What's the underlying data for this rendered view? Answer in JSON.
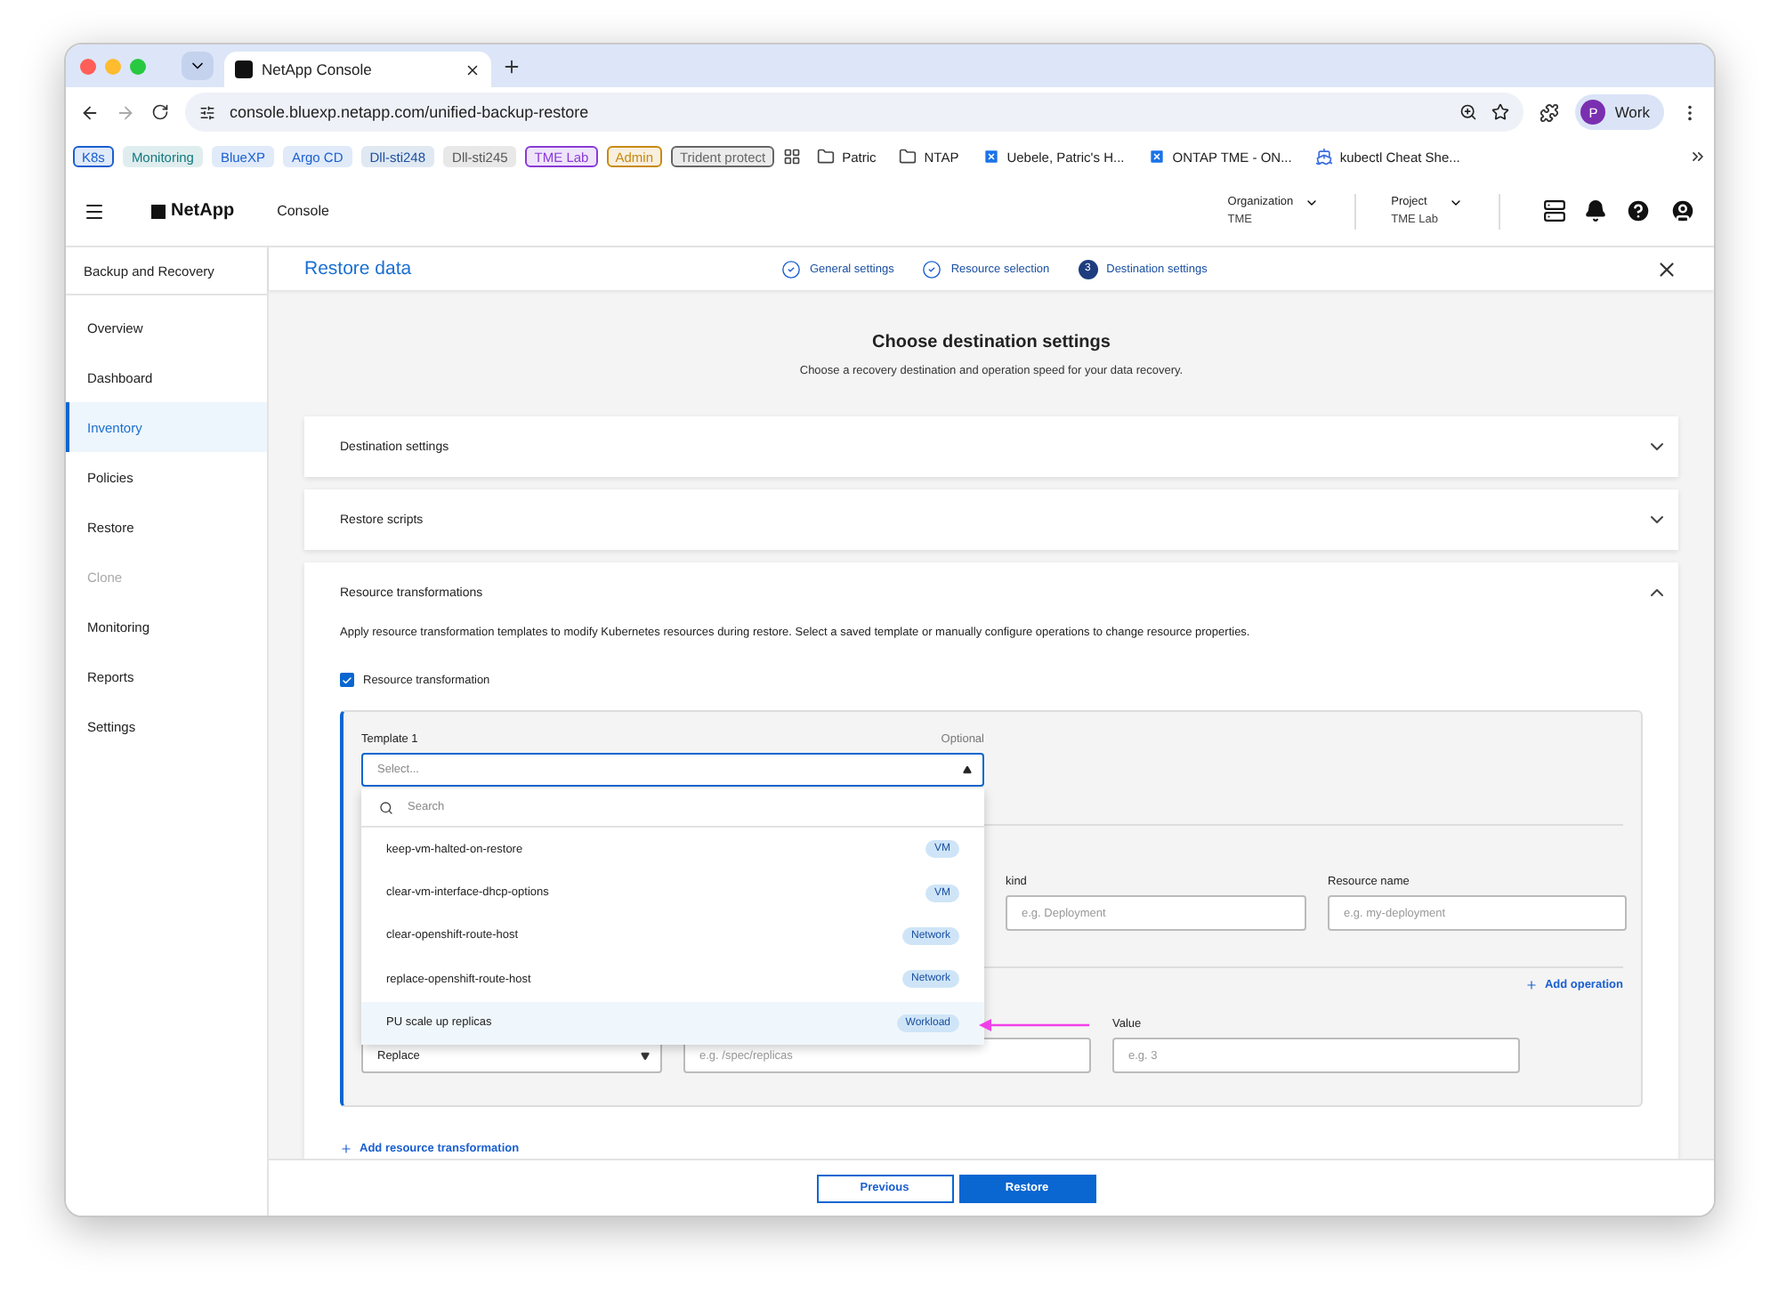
{
  "browser": {
    "tab_title": "NetApp Console",
    "url": "console.bluexp.netapp.com/unified-backup-restore",
    "profile": {
      "initial": "P",
      "name": "Work"
    },
    "bookmarks": [
      {
        "kind": "chip",
        "label": "K8s",
        "color": "#1a5fd0",
        "outlined": true
      },
      {
        "kind": "chip",
        "label": "Monitoring",
        "color": "#137a7f",
        "outlined": false
      },
      {
        "kind": "chip",
        "label": "BlueXP",
        "color": "#1a5fd0",
        "outlined": false
      },
      {
        "kind": "chip",
        "label": "Argo CD",
        "color": "#1a5fd0",
        "outlined": false
      },
      {
        "kind": "chip",
        "label": "Dll-sti248",
        "color": "#1a4fa0",
        "outlined": false
      },
      {
        "kind": "chip",
        "label": "Dll-sti245",
        "color": "#555555",
        "outlined": false
      },
      {
        "kind": "chip",
        "label": "TME Lab",
        "color": "#8a3ad6",
        "outlined": true
      },
      {
        "kind": "chip",
        "label": "Admin",
        "color": "#c88a10",
        "outlined": true
      },
      {
        "kind": "chip",
        "label": "Trident protect",
        "color": "#666666",
        "outlined": true
      },
      {
        "kind": "apps"
      },
      {
        "kind": "folder",
        "label": "Patric"
      },
      {
        "kind": "folder",
        "label": "NTAP"
      },
      {
        "kind": "page",
        "label": "Uebele, Patric's H..."
      },
      {
        "kind": "page",
        "label": "ONTAP TME - ON..."
      },
      {
        "kind": "wheel",
        "label": "kubectl Cheat She..."
      }
    ]
  },
  "app_header": {
    "logo": "NetApp",
    "product": "Console",
    "organization": {
      "label": "Organization",
      "value": "TME"
    },
    "project": {
      "label": "Project",
      "value": "TME Lab"
    }
  },
  "sidebar": {
    "title": "Backup and Recovery",
    "items": [
      {
        "label": "Overview",
        "selected": false,
        "disabled": false
      },
      {
        "label": "Dashboard",
        "selected": false,
        "disabled": false
      },
      {
        "label": "Inventory",
        "selected": true,
        "disabled": false
      },
      {
        "label": "Policies",
        "selected": false,
        "disabled": false
      },
      {
        "label": "Restore",
        "selected": false,
        "disabled": false
      },
      {
        "label": "Clone",
        "selected": false,
        "disabled": true
      },
      {
        "label": "Monitoring",
        "selected": false,
        "disabled": false
      },
      {
        "label": "Reports",
        "selected": false,
        "disabled": false
      },
      {
        "label": "Settings",
        "selected": false,
        "disabled": false
      }
    ]
  },
  "page": {
    "title": "Restore data",
    "steps": [
      {
        "label": "General settings",
        "completed": true
      },
      {
        "label": "Resource selection",
        "completed": true
      },
      {
        "label": "Destination settings",
        "completed": false,
        "number": "3"
      }
    ],
    "heading": "Choose destination settings",
    "subheading": "Choose a recovery destination and operation speed for your data recovery.",
    "sections": [
      {
        "title": "Destination settings",
        "expanded": false
      },
      {
        "title": "Restore scripts",
        "expanded": false
      },
      {
        "title": "Resource transformations",
        "expanded": true,
        "content": {
          "description": "Apply resource transformation templates to modify Kubernetes resources during restore. Select a saved template or manually configure operations to change resource properties.",
          "checkbox": {
            "label": "Resource transformation",
            "checked": true
          },
          "template": {
            "label": "Template 1",
            "hint": "Optional",
            "placeholder": "Select...",
            "open": true,
            "dropdown": {
              "search_placeholder": "Search",
              "options": [
                {
                  "name": "keep-vm-halted-on-restore",
                  "tag": "VM",
                  "selected": false
                },
                {
                  "name": "clear-vm-interface-dhcp-options",
                  "tag": "VM",
                  "selected": false
                },
                {
                  "name": "clear-openshift-route-host",
                  "tag": "Network",
                  "selected": false
                },
                {
                  "name": "replace-openshift-route-host",
                  "tag": "Network",
                  "selected": false
                },
                {
                  "name": "PU scale up replicas",
                  "tag": "Workload",
                  "selected": true
                }
              ]
            },
            "fields": [
              {
                "label": "kind",
                "placeholder": "e.g. Deployment"
              },
              {
                "label": "Resource name",
                "placeholder": "e.g. my-deployment"
              }
            ],
            "add_operation": "Add operation",
            "operation": {
              "value": "Replace",
              "path_placeholder": "e.g. /spec/replicas",
              "value_label": "Value",
              "value_placeholder": "e.g. 3"
            }
          },
          "add_transformation": "Add resource transformation"
        }
      }
    ],
    "buttons": {
      "previous": "Previous",
      "restore": "Restore"
    }
  }
}
